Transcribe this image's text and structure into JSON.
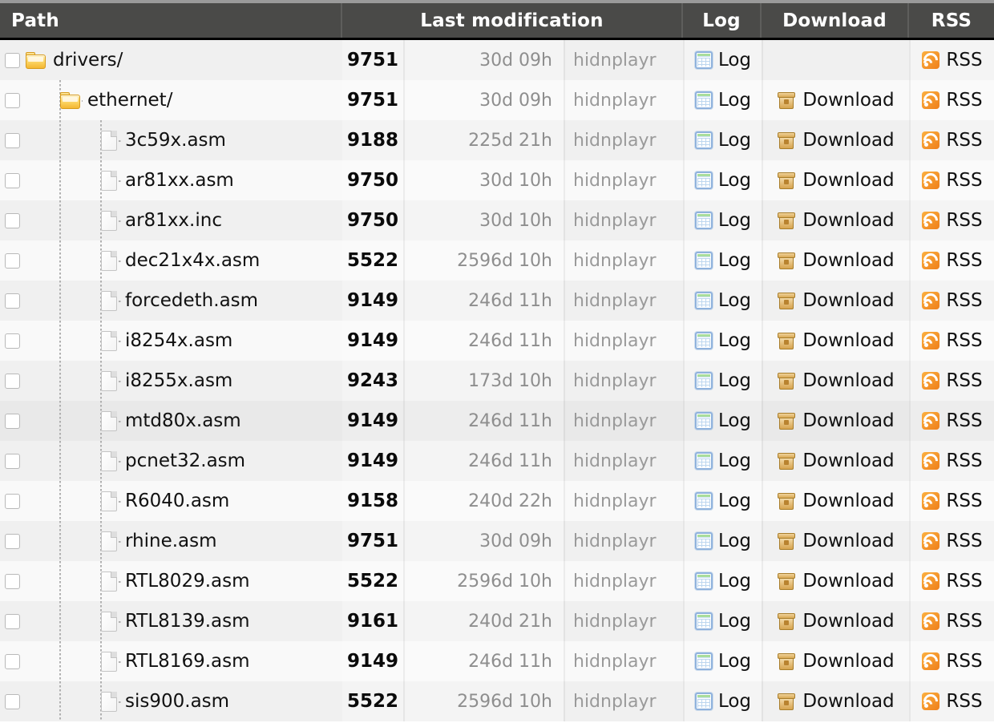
{
  "header": {
    "columns": [
      {
        "key": "path",
        "label": "Path"
      },
      {
        "key": "lastmod",
        "label": "Last modification"
      },
      {
        "key": "log",
        "label": "Log"
      },
      {
        "key": "download",
        "label": "Download"
      },
      {
        "key": "rss",
        "label": "RSS"
      }
    ]
  },
  "labels": {
    "log": "Log",
    "download": "Download",
    "rss": "RSS"
  },
  "icons": {
    "folder": "folder-icon",
    "file": "file-icon",
    "log": "log-spreadsheet-icon",
    "download": "archive-box-icon",
    "rss": "rss-feed-icon",
    "checkbox": "row-select-checkbox"
  },
  "colors": {
    "header_bg": "#4a4a48",
    "header_text": "#ffffff",
    "row_odd": "#f0f0f0",
    "row_even": "#f9f9f9",
    "row_hover": "#e9e9e9",
    "folder": "#f4b731",
    "rss": "#ef7f1a",
    "download": "#d7a44f",
    "log": "#8fb2dd",
    "muted_text": "#9a9a9a"
  },
  "rows": [
    {
      "name": "drivers/",
      "type": "folder",
      "depth": 0,
      "revision": "9751",
      "age": "30d 09h",
      "author": "hidnplayr",
      "has_download": false,
      "hover": false
    },
    {
      "name": "ethernet/",
      "type": "folder",
      "depth": 1,
      "revision": "9751",
      "age": "30d 09h",
      "author": "hidnplayr",
      "has_download": true,
      "hover": false
    },
    {
      "name": "3c59x.asm",
      "type": "file",
      "depth": 2,
      "revision": "9188",
      "age": "225d 21h",
      "author": "hidnplayr",
      "has_download": true,
      "hover": false
    },
    {
      "name": "ar81xx.asm",
      "type": "file",
      "depth": 2,
      "revision": "9750",
      "age": "30d 10h",
      "author": "hidnplayr",
      "has_download": true,
      "hover": false
    },
    {
      "name": "ar81xx.inc",
      "type": "file",
      "depth": 2,
      "revision": "9750",
      "age": "30d 10h",
      "author": "hidnplayr",
      "has_download": true,
      "hover": false
    },
    {
      "name": "dec21x4x.asm",
      "type": "file",
      "depth": 2,
      "revision": "5522",
      "age": "2596d 10h",
      "author": "hidnplayr",
      "has_download": true,
      "hover": false
    },
    {
      "name": "forcedeth.asm",
      "type": "file",
      "depth": 2,
      "revision": "9149",
      "age": "246d 11h",
      "author": "hidnplayr",
      "has_download": true,
      "hover": false
    },
    {
      "name": "i8254x.asm",
      "type": "file",
      "depth": 2,
      "revision": "9149",
      "age": "246d 11h",
      "author": "hidnplayr",
      "has_download": true,
      "hover": false
    },
    {
      "name": "i8255x.asm",
      "type": "file",
      "depth": 2,
      "revision": "9243",
      "age": "173d 10h",
      "author": "hidnplayr",
      "has_download": true,
      "hover": false
    },
    {
      "name": "mtd80x.asm",
      "type": "file",
      "depth": 2,
      "revision": "9149",
      "age": "246d 11h",
      "author": "hidnplayr",
      "has_download": true,
      "hover": true
    },
    {
      "name": "pcnet32.asm",
      "type": "file",
      "depth": 2,
      "revision": "9149",
      "age": "246d 11h",
      "author": "hidnplayr",
      "has_download": true,
      "hover": false
    },
    {
      "name": "R6040.asm",
      "type": "file",
      "depth": 2,
      "revision": "9158",
      "age": "240d 22h",
      "author": "hidnplayr",
      "has_download": true,
      "hover": false
    },
    {
      "name": "rhine.asm",
      "type": "file",
      "depth": 2,
      "revision": "9751",
      "age": "30d 09h",
      "author": "hidnplayr",
      "has_download": true,
      "hover": false
    },
    {
      "name": "RTL8029.asm",
      "type": "file",
      "depth": 2,
      "revision": "5522",
      "age": "2596d 10h",
      "author": "hidnplayr",
      "has_download": true,
      "hover": false
    },
    {
      "name": "RTL8139.asm",
      "type": "file",
      "depth": 2,
      "revision": "9161",
      "age": "240d 21h",
      "author": "hidnplayr",
      "has_download": true,
      "hover": false
    },
    {
      "name": "RTL8169.asm",
      "type": "file",
      "depth": 2,
      "revision": "9149",
      "age": "246d 11h",
      "author": "hidnplayr",
      "has_download": true,
      "hover": false
    },
    {
      "name": "sis900.asm",
      "type": "file",
      "depth": 2,
      "revision": "5522",
      "age": "2596d 10h",
      "author": "hidnplayr",
      "has_download": true,
      "hover": false
    }
  ]
}
